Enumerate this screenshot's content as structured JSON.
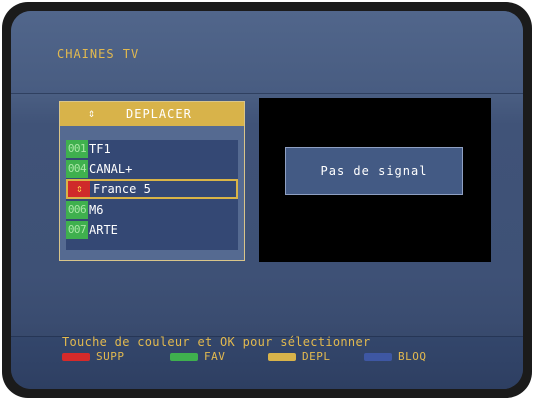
{
  "screen": {
    "title": "CHAINES TV"
  },
  "panel": {
    "header_icon": "up-down-arrows-icon",
    "header_label": "DEPLACER"
  },
  "channels": [
    {
      "number": "001",
      "name": "TF1"
    },
    {
      "number": "004",
      "name": "CANAL+"
    },
    {
      "number": "",
      "name": "France 5",
      "selected": true,
      "icon": "up-down-arrows-icon"
    },
    {
      "number": "006",
      "name": "M6"
    },
    {
      "number": "007",
      "name": "ARTE"
    }
  ],
  "preview": {
    "message": "Pas de signal"
  },
  "footer": {
    "hint": "Touche de couleur et OK pour sélectionner",
    "legend": [
      {
        "label": "SUPP",
        "color": "#d62a2a"
      },
      {
        "label": "FAV",
        "color": "#3fb04e"
      },
      {
        "label": "DEPL",
        "color": "#d8b34a"
      },
      {
        "label": "BLOQ",
        "color": "#3e57a3"
      }
    ]
  },
  "colors": {
    "accent_yellow": "#e2b94f",
    "background_blue": "#4a5e82",
    "selection_border": "#d9b447"
  }
}
